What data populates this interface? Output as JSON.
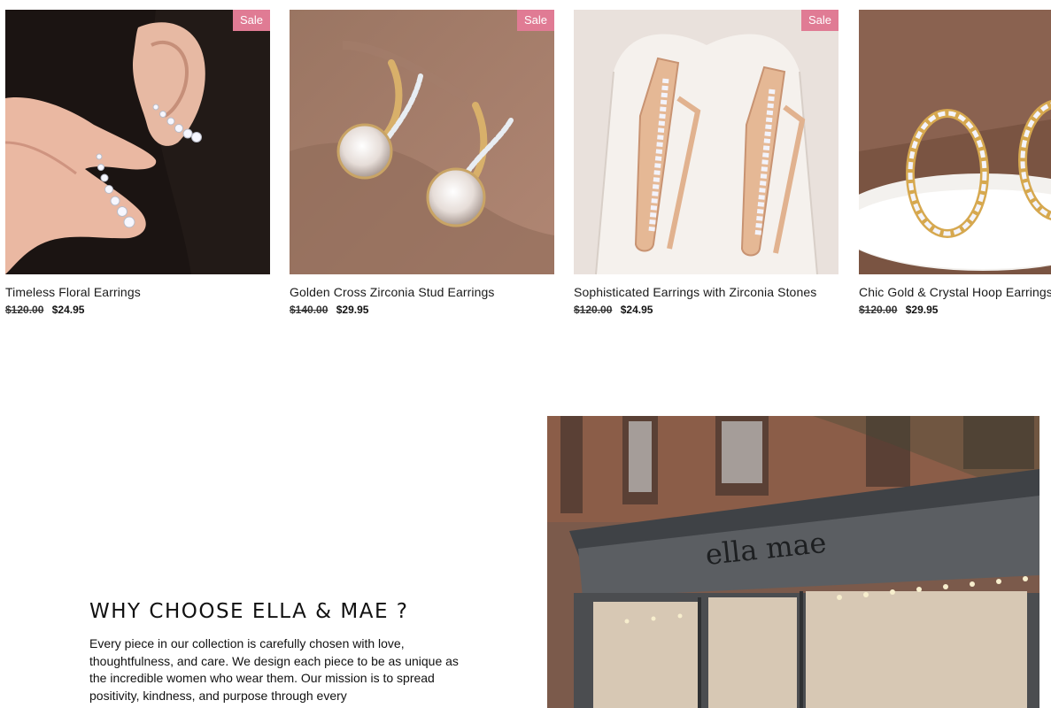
{
  "products": [
    {
      "title": "Timeless Floral Earrings",
      "old_price": "$120.00",
      "price": "$24.95",
      "badge": "Sale"
    },
    {
      "title": "Golden Cross Zirconia Stud Earrings",
      "old_price": "$140.00",
      "price": "$29.95",
      "badge": "Sale"
    },
    {
      "title": "Sophisticated Earrings with Zirconia Stones",
      "old_price": "$120.00",
      "price": "$24.95",
      "badge": "Sale"
    },
    {
      "title": "Chic Gold & Crystal Hoop Earrings",
      "old_price": "$120.00",
      "price": "$29.95",
      "badge": ""
    }
  ],
  "about": {
    "heading": "WHY CHOOSE ELLA & MAE ?",
    "body": "Every piece in our collection is carefully chosen with love, thoughtfulness, and care. We design each piece to be as unique as the incredible women who wear them. Our mission is to spread positivity, kindness, and purpose through every"
  },
  "storefront": {
    "sign_text": "ella mae"
  },
  "colors": {
    "sale_badge": "#e07b94"
  }
}
